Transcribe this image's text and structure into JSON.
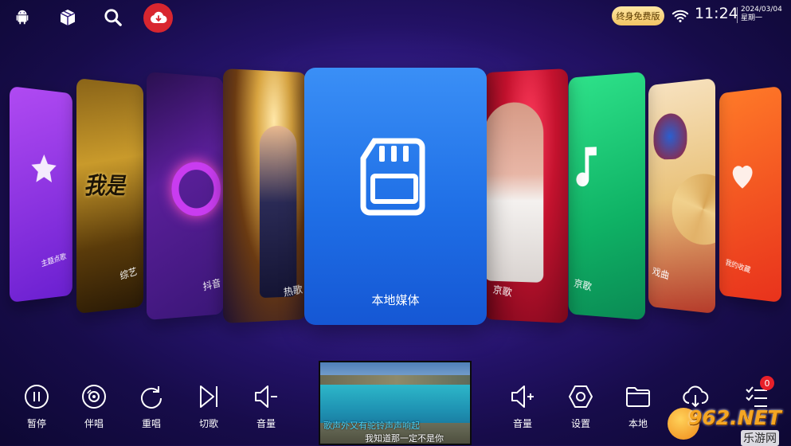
{
  "topbar": {
    "icons": [
      "android-icon",
      "package-icon",
      "search-icon",
      "cloud-download-icon"
    ],
    "vip_label": "终身免费版",
    "time": "11:24",
    "date": "2024/03/04",
    "weekday": "星期一"
  },
  "cards": [
    {
      "label": "主题点歌"
    },
    {
      "label": "综艺"
    },
    {
      "label": "抖音"
    },
    {
      "label": "热歌"
    },
    {
      "label": "本地媒体"
    },
    {
      "label": "京歌"
    },
    {
      "label": "京歌"
    },
    {
      "label": "戏曲"
    },
    {
      "label": "我的收藏"
    }
  ],
  "controls": [
    {
      "label": "暂停",
      "icon": "pause-icon"
    },
    {
      "label": "伴唱",
      "icon": "disc-icon"
    },
    {
      "label": "重唱",
      "icon": "replay-icon"
    },
    {
      "label": "切歌",
      "icon": "skip-next-icon"
    },
    {
      "label": "音量",
      "icon": "volume-down-icon"
    },
    {
      "label": "音量",
      "icon": "volume-up-icon"
    },
    {
      "label": "设置",
      "icon": "settings-icon"
    },
    {
      "label": "本地",
      "icon": "folder-icon"
    }
  ],
  "lyrics": {
    "line1": "歌声外又有驼铃声声响起",
    "line2": "我知道那一定不是你"
  },
  "queue_badge": "0",
  "watermark": {
    "brand": "962.NET",
    "sub": "乐游网"
  },
  "colors": {
    "accent_blue": "#1f6fe6",
    "vip_gold": "#f2c463",
    "badge_red": "#e8202a"
  }
}
